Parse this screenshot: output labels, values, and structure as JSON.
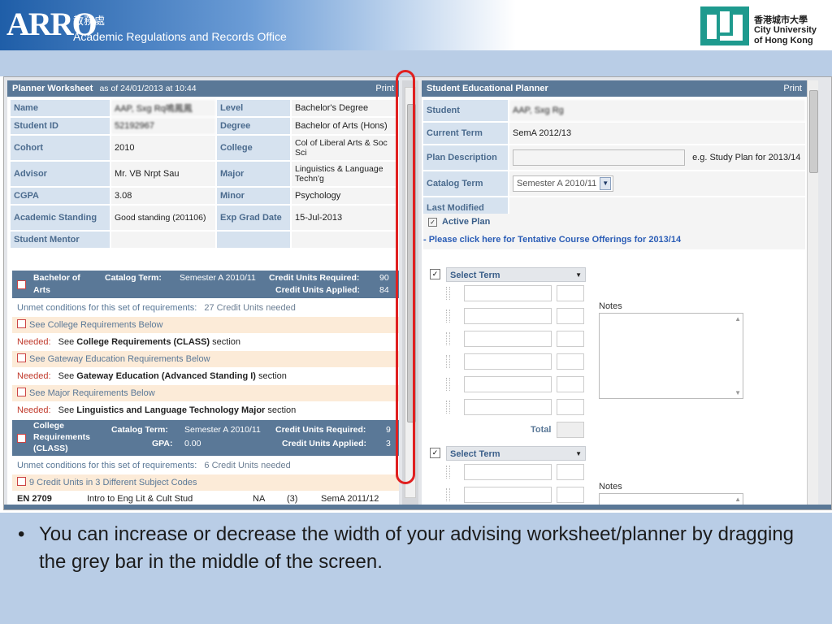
{
  "header": {
    "arro_logo": "ARRO",
    "arro_chinese": "教務處",
    "arro_name": "Academic Regulations and Records Office",
    "university_chinese": "香港城市大學",
    "university_line1": "City University",
    "university_line2": "of Hong Kong"
  },
  "worksheet": {
    "title": "Planner Worksheet",
    "as_of": "as of 24/01/2013 at 10:44",
    "print": "Print",
    "rows": [
      {
        "l1": "Name",
        "v1": "AAP, Sxg Rq鳴鳳鳳",
        "l2": "Level",
        "v2": "Bachelor's Degree"
      },
      {
        "l1": "Student ID",
        "v1": "52192967",
        "l2": "Degree",
        "v2": "Bachelor of Arts (Hons)"
      },
      {
        "l1": "Cohort",
        "v1": "2010",
        "l2": "College",
        "v2": "Col of Liberal Arts & Soc Sci"
      },
      {
        "l1": "Advisor",
        "v1": "Mr. VB Nrpt Sau",
        "l2": "Major",
        "v2": "Linguistics & Language Techn'g"
      },
      {
        "l1": "CGPA",
        "v1": "3.08",
        "l2": "Minor",
        "v2": "Psychology"
      },
      {
        "l1": "Academic Standing",
        "v1": "Good standing (201106)",
        "l2": "Exp Grad Date",
        "v2": "15-Jul-2013"
      },
      {
        "l1": "Student Mentor",
        "v1": "",
        "l2": "",
        "v2": ""
      }
    ],
    "block1": {
      "name_line1": "Bachelor of",
      "name_line2": "Arts",
      "catalog_label": "Catalog Term:",
      "catalog_value": "Semester A 2010/11",
      "required_label": "Credit Units Required:",
      "required_value": "90",
      "applied_label": "Credit Units Applied:",
      "applied_value": "84",
      "unmet_label": "Unmet conditions for this set of requirements:",
      "unmet_value": "27 Credit Units needed",
      "items": [
        {
          "see": "See College Requirements Below",
          "needed": "Needed:",
          "see_word": "See",
          "link": "College Requirements (CLASS)",
          "suffix": "section"
        },
        {
          "see": "See Gateway Education Requirements Below",
          "needed": "Needed:",
          "see_word": "See",
          "link": "Gateway Education (Advanced Standing I)",
          "suffix": "section"
        },
        {
          "see": "See Major Requirements Below",
          "needed": "Needed:",
          "see_word": "See",
          "link": "Linguistics and Language Technology Major",
          "suffix": "section"
        }
      ]
    },
    "block2": {
      "name_line1": "College",
      "name_line2": "Requirements",
      "name_line3": "(CLASS)",
      "catalog_label": "Catalog Term:",
      "catalog_value": "Semester A 2010/11",
      "required_label": "Credit Units Required:",
      "required_value": "9",
      "gpa_label": "GPA:",
      "gpa_value": "0.00",
      "applied_label": "Credit Units Applied:",
      "applied_value": "3",
      "unmet_label": "Unmet conditions for this set of requirements:",
      "unmet_value": "6 Credit Units needed",
      "sub_req": "9 Credit Units in 3 Different Subject Codes",
      "course": {
        "code": "EN 2709",
        "title": "Intro to Eng Lit & Cult Stud",
        "grade": "NA",
        "units": "(3)",
        "term": "SemA 2011/12"
      }
    }
  },
  "planner": {
    "title": "Student Educational Planner",
    "print": "Print",
    "student_label": "Student",
    "student_value": "AAP, Sxg Rg",
    "current_term_label": "Current Term",
    "current_term_value": "SemA 2012/13",
    "plan_desc_label": "Plan Description",
    "plan_desc_hint": "e.g. Study Plan for 2013/14",
    "catalog_term_label": "Catalog Term",
    "catalog_term_value": "Semester A 2010/11",
    "last_modified_label": "Last Modified",
    "active_plan_label": "Active Plan",
    "offerings_link": "- Please click here for Tentative Course Offerings for 2013/14",
    "select_term_label": "Select Term",
    "notes_label": "Notes",
    "total_label": "Total"
  },
  "caption": {
    "bullet": "•",
    "text": "You can increase or decrease the width of your advising worksheet/planner by dragging the grey bar in the middle of the screen."
  }
}
